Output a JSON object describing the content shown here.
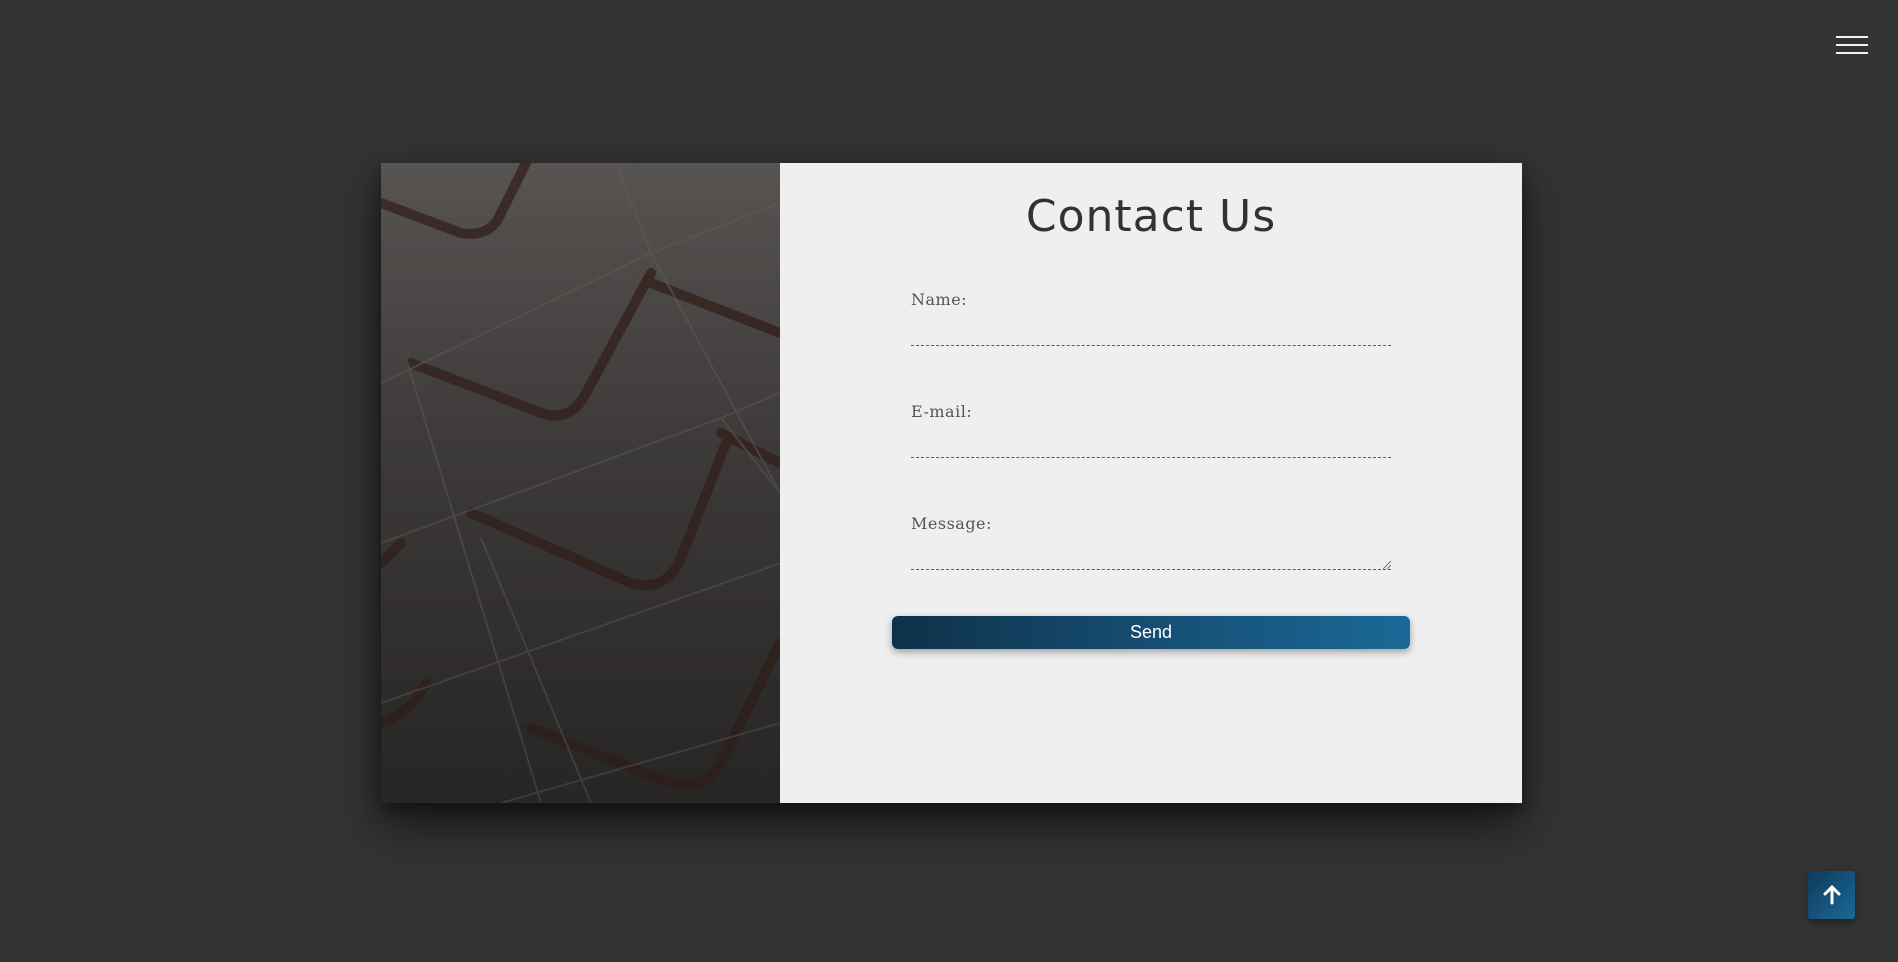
{
  "nav": {
    "menu_icon": "hamburger-menu-icon"
  },
  "contact": {
    "title": "Contact Us",
    "fields": {
      "name_label": "Name:",
      "email_label": "E-mail:",
      "message_label": "Message:"
    },
    "send_label": "Send"
  },
  "scroll_top": {
    "icon": "arrow-up-icon"
  },
  "colors": {
    "page_background": "#333333",
    "form_background": "#efefef",
    "title_color": "#2f3337",
    "button_gradient_start": "#0e3149",
    "button_gradient_end": "#1a6997"
  }
}
